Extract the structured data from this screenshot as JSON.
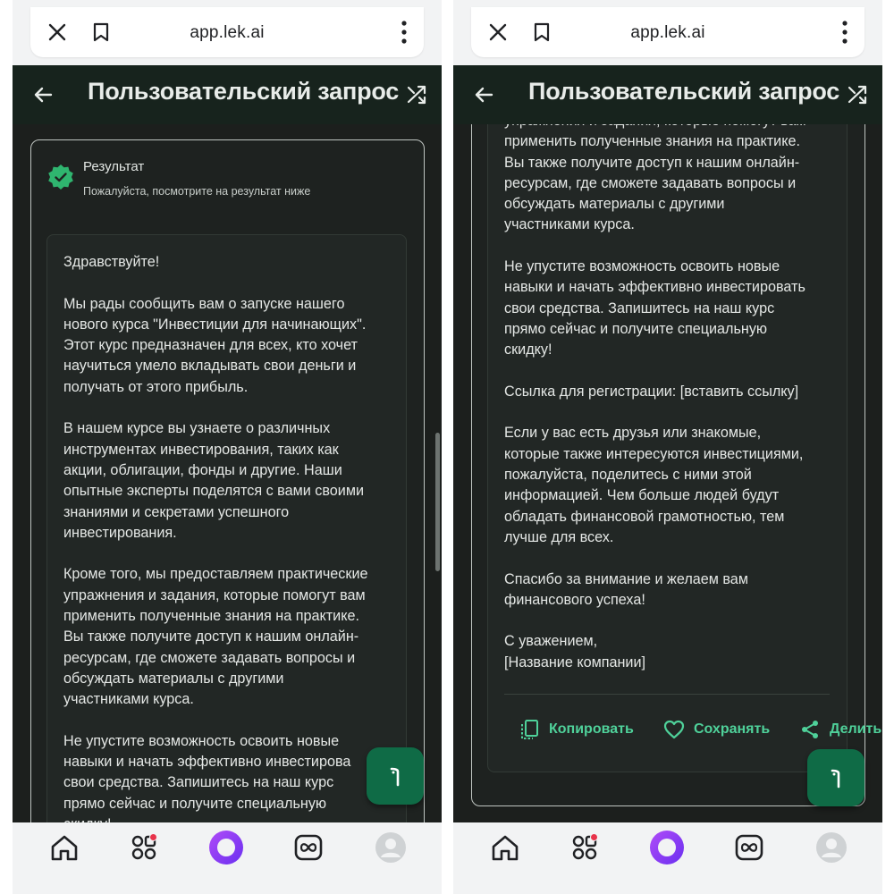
{
  "browser": {
    "url": "app.lek.ai"
  },
  "appbar": {
    "title": "Пользовательский запрос"
  },
  "result": {
    "title": "Результат",
    "subtitle": "Пожалуйста, посмотрите на результат ниже"
  },
  "left_message_lines": [
    "Здравствуйте!",
    "",
    "Мы рады сообщить вам о запуске нашего",
    "нового курса \"Инвестиции для начинающих\".",
    "Этот курс предназначен для всех, кто хочет",
    "научиться умело вкладывать свои деньги и",
    "получать от этого прибыль.",
    "",
    "В нашем курсе вы узнаете о различных",
    "инструментах инвестирования, таких как",
    "акции, облигации, фонды и другие. Наши",
    "опытные эксперты поделятся с вами своими",
    "знаниями и секретами успешного",
    "инвестирования.",
    "",
    "Кроме того, мы предоставляем практические",
    "упражнения и задания, которые помогут вам",
    "применить полученные знания на практике.",
    "Вы также получите доступ к нашим онлайн-",
    "ресурсам, где сможете задавать вопросы и",
    "обсуждать материалы с другими",
    "участниками курса.",
    "",
    "Не упустите возможность освоить новые",
    "навыки и начать эффективно инвестирова",
    "свои средства. Запишитесь на наш курс",
    "прямо сейчас и получите специальную",
    "скидку!"
  ],
  "right_message_lines": [
    "упражнения и задания, которые помогут вам",
    "применить полученные знания на практике.",
    "Вы также получите доступ к нашим онлайн-",
    "ресурсам, где сможете задавать вопросы и",
    "обсуждать материалы с другими",
    "участниками курса.",
    "",
    "Не упустите возможность освоить новые",
    "навыки и начать эффективно инвестировать",
    "свои средства. Запишитесь на наш курс",
    "прямо сейчас и получите специальную",
    "скидку!",
    "",
    "Ссылка для регистрации: [вставить ссылку]",
    "",
    "Если у вас есть друзья или знакомые,",
    "которые также интересуются инвестициями,",
    "пожалуйста, поделитесь с ними этой",
    "информацией. Чем больше людей будут",
    "обладать финансовой грамотностью, тем",
    "лучше для всех.",
    "",
    "Спасибо за внимание и желаем вам",
    "финансового успеха!",
    "",
    "С уважением,",
    "[Название компании]"
  ],
  "actions": {
    "copy": "Копировать",
    "save": "Сохранять",
    "share": "Делить"
  },
  "colors": {
    "appbar_bg": "#17231d",
    "content_bg": "#1c1f1d",
    "accent_green": "#4fd19a",
    "fab_bg": "#0f6b46",
    "alice_purple": "#8a3cf0",
    "notification_red": "#e8334a"
  },
  "icons": {
    "browser": [
      "close-icon",
      "bookmark-icon",
      "more-vert-icon"
    ],
    "appbar": [
      "back-arrow-icon",
      "shuffle-icon"
    ],
    "result": "check-badge-icon",
    "fab": "assistant-icon",
    "actions": [
      "copy-icon",
      "heart-icon",
      "share-icon"
    ],
    "nav": [
      "home-icon",
      "apps-icon",
      "alice-icon",
      "infinity-icon",
      "avatar-icon"
    ]
  }
}
